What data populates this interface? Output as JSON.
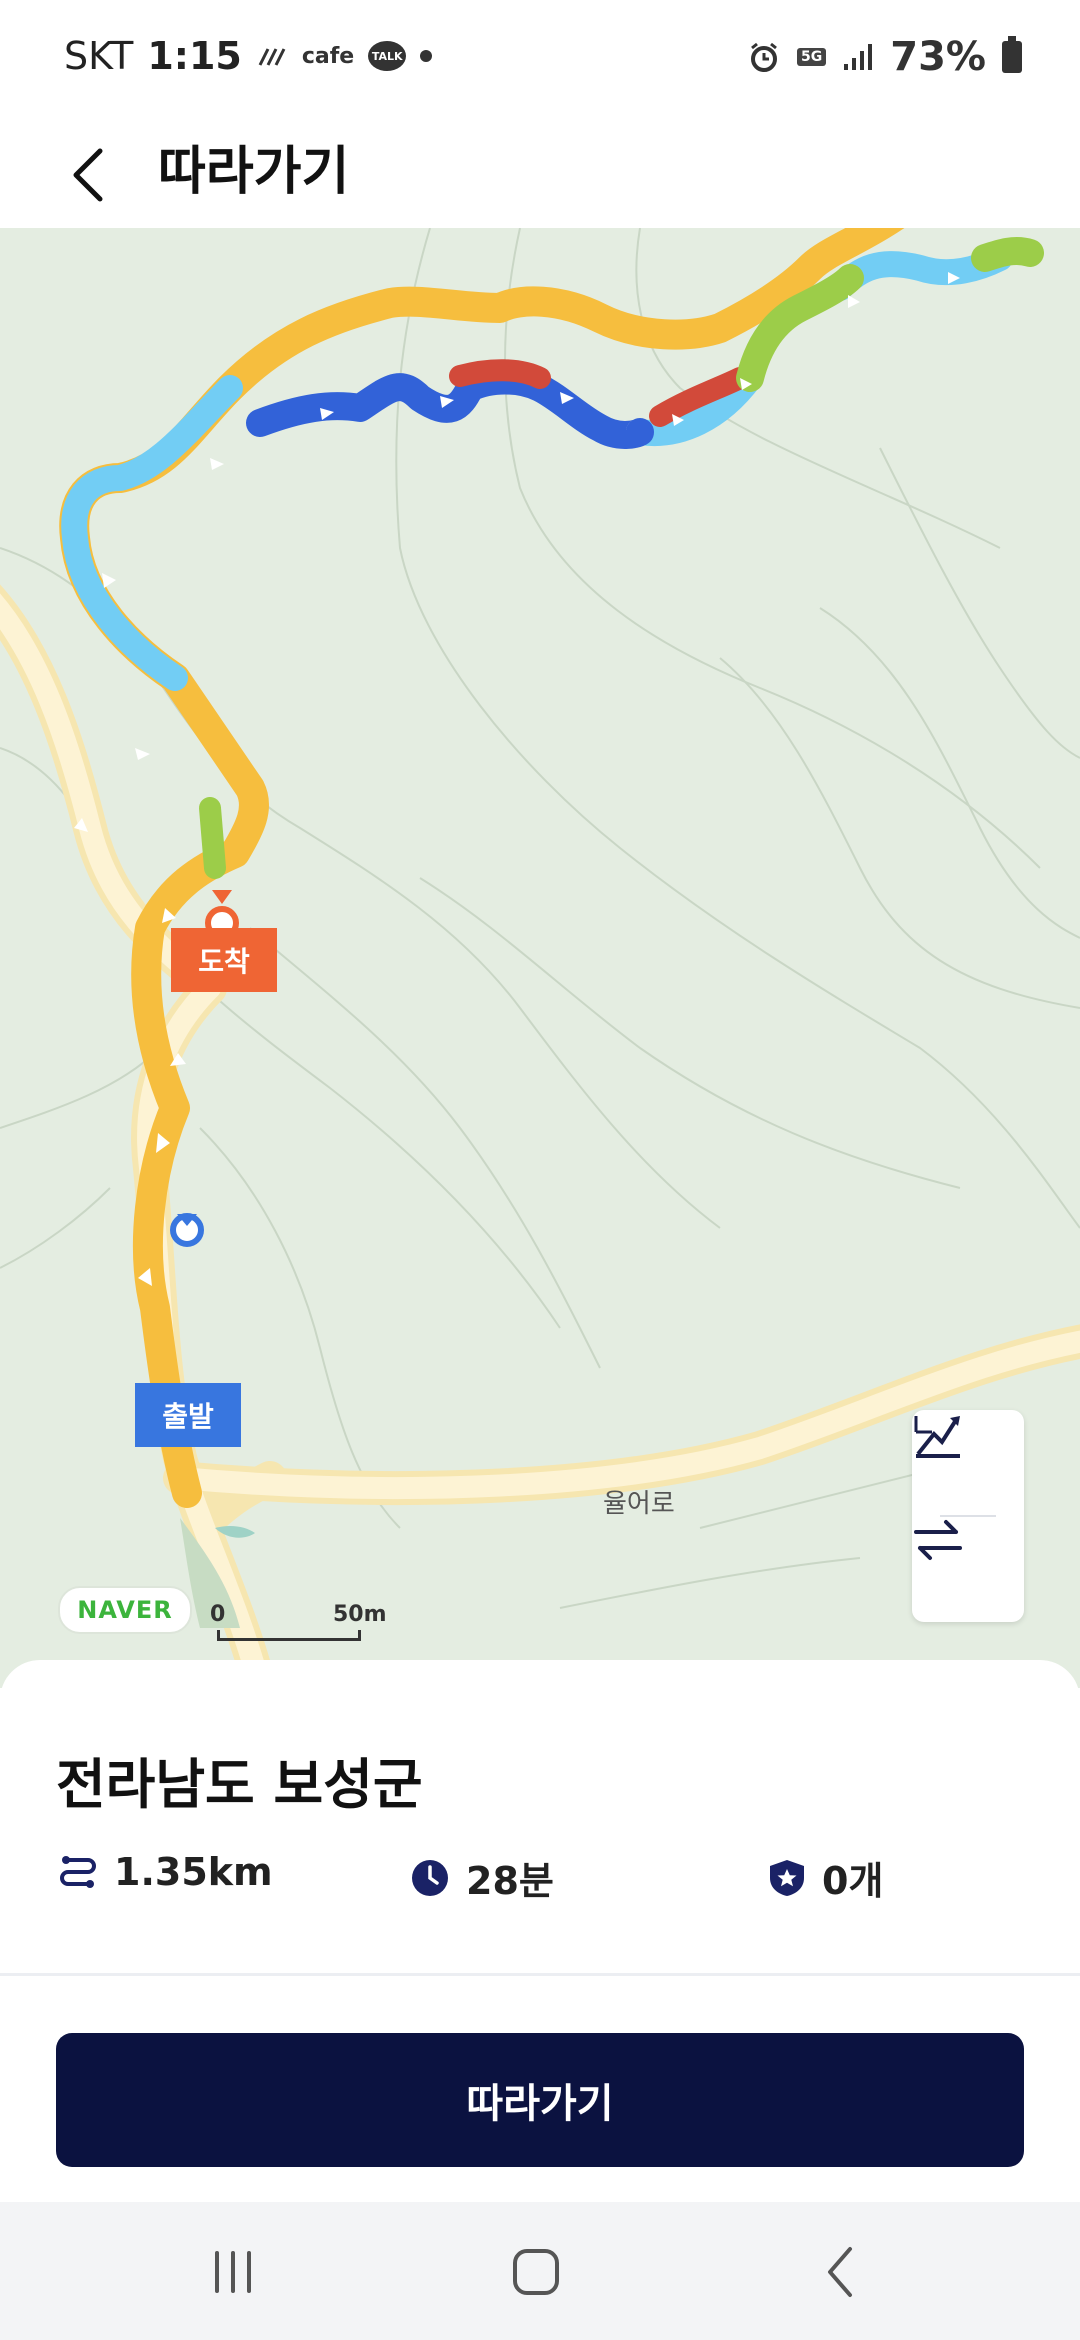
{
  "status_bar": {
    "carrier": "SKT",
    "time": "1:15",
    "cafe_label": "cafe",
    "talk_label": "TALK",
    "network": "5G",
    "battery": "73%"
  },
  "header": {
    "title": "따라가기"
  },
  "map": {
    "arrive_label": "도착",
    "start_label": "출발",
    "road_label": "율어로",
    "naver_logo": "NAVER",
    "scale_zero": "0",
    "scale_label": "50m",
    "route_colors": {
      "yellow": "#f6be3e",
      "light_blue": "#72cdf4",
      "dark_blue": "#3262d8",
      "red": "#d24a3a",
      "green": "#9ccd49"
    },
    "controls": [
      "elevation-icon",
      "swap-icon"
    ]
  },
  "sheet": {
    "region": "전라남도 보성군",
    "distance": "1.35km",
    "duration": "28분",
    "badge_count": "0개",
    "follow_button": "따라가기"
  },
  "navbar": {
    "icons": [
      "recent-apps-icon",
      "home-icon",
      "back-icon"
    ]
  }
}
